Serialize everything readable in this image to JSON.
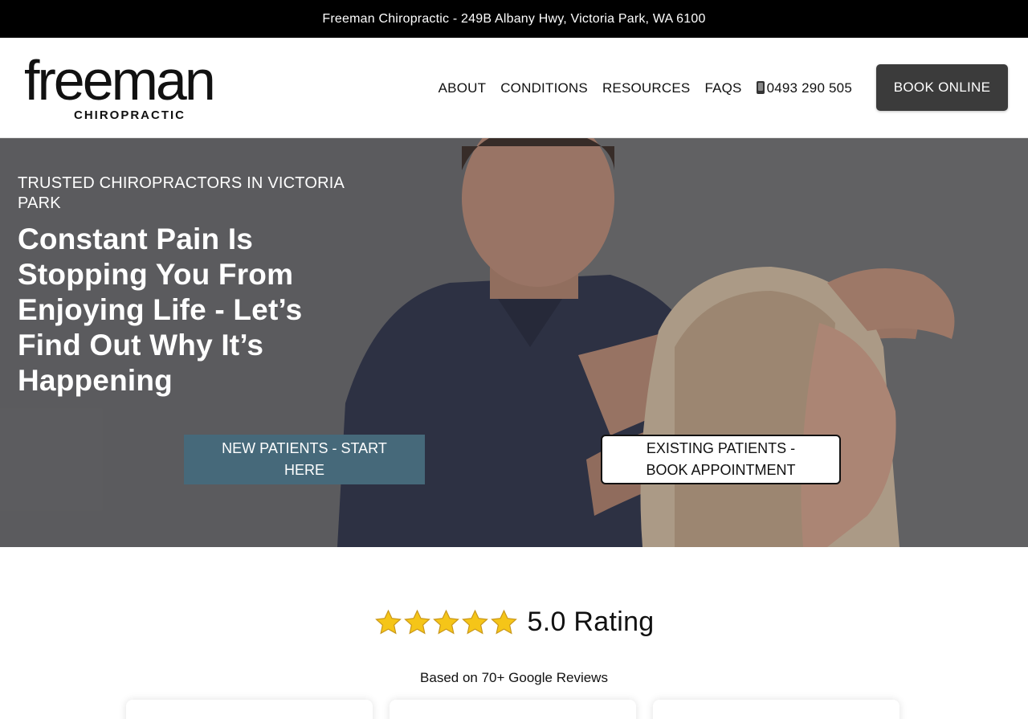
{
  "topbar": {
    "address": "Freeman Chiropractic - 249B Albany Hwy, Victoria Park, WA 6100"
  },
  "header": {
    "logo": {
      "wordmark": "freeman",
      "subtitle": "CHIROPRACTIC"
    },
    "nav": [
      {
        "label": "ABOUT"
      },
      {
        "label": "CONDITIONS"
      },
      {
        "label": "RESOURCES"
      },
      {
        "label": "FAQS"
      }
    ],
    "phone": {
      "icon": "phone-icon",
      "number": "0493 290 505"
    },
    "book_button": "BOOK ONLINE"
  },
  "hero": {
    "eyebrow": "TRUSTED CHIROPRACTORS IN VICTORIA PARK",
    "title": "Constant Pain Is Stopping You From Enjoying Life - Let’s Find Out Why It’s Happening",
    "new_patients_button": "NEW PATIENTS - START HERE",
    "existing_patients_button": "EXISTING PATIENTS - BOOK APPOINTMENT"
  },
  "rating": {
    "stars": 5,
    "star_icon": "star-icon",
    "text": "5.0 Rating",
    "subtext": "Based on 70+ Google Reviews"
  },
  "colors": {
    "topbar_bg": "#000000",
    "book_button_bg": "#3b3b3b",
    "new_patients_bg": "#46697a",
    "star_gold": "#f5c518"
  }
}
